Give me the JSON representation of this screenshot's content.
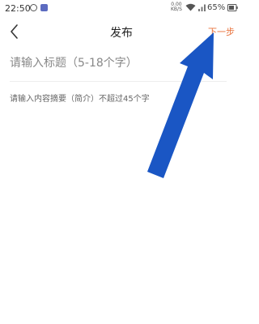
{
  "status_bar": {
    "time": "22:50",
    "net_speed_value": "0.00",
    "net_speed_unit": "KB/S",
    "battery_percent": "65%"
  },
  "header": {
    "title": "发布",
    "next_label": "下一步",
    "back_icon": "chevron-left-icon"
  },
  "form": {
    "title_placeholder": "请输入标题（5-18个字）",
    "summary_placeholder": "请输入内容摘要（简介）不超过45个字"
  },
  "colors": {
    "accent": "#e8713a",
    "annotation": "#1a56c4"
  }
}
